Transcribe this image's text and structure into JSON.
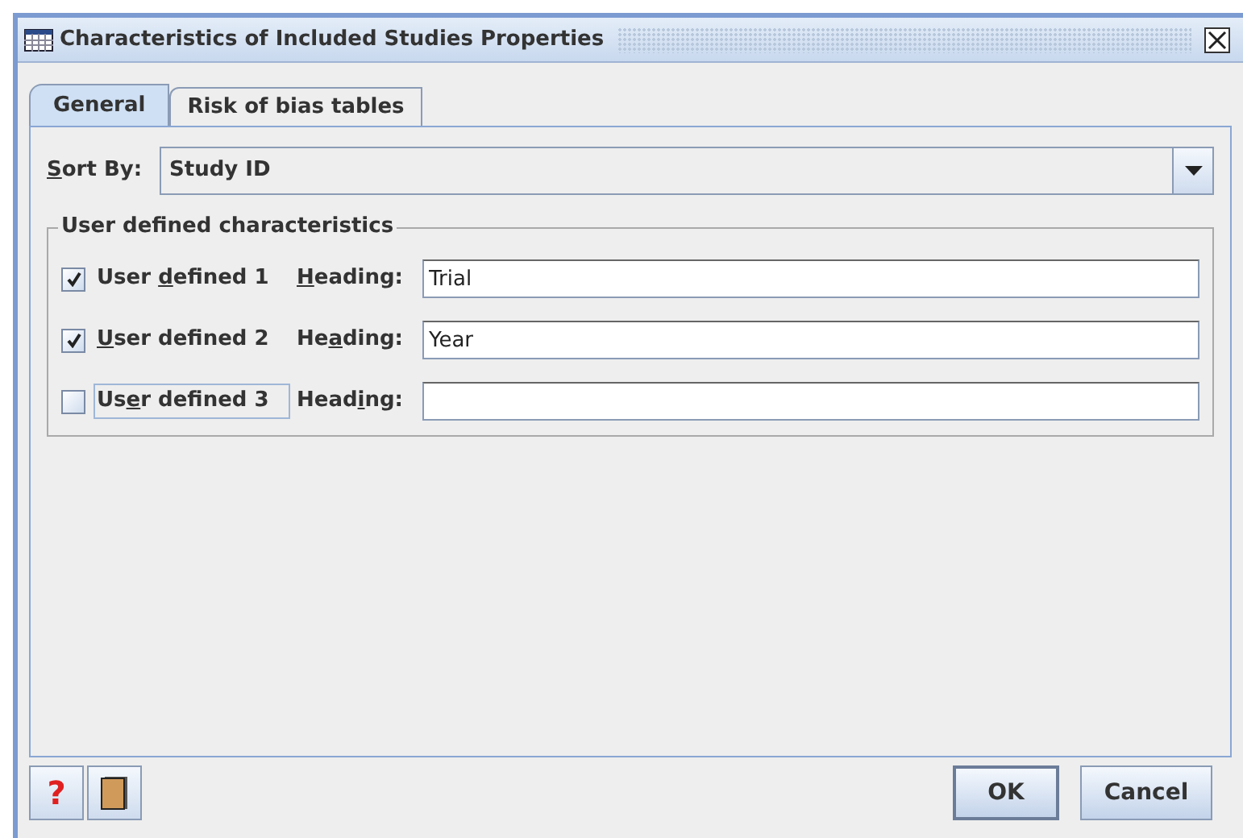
{
  "window": {
    "title": "Characteristics of Included Studies Properties"
  },
  "tabs": [
    {
      "label": "General",
      "selected": true
    },
    {
      "label": "Risk of bias tables",
      "selected": false
    }
  ],
  "sort_by": {
    "label": {
      "mnemonic": "S",
      "after": "ort By:"
    },
    "value": "Study ID"
  },
  "group": {
    "title": "User defined characteristics",
    "rows": [
      {
        "label": {
          "before": "User ",
          "mnemonic": "d",
          "after": "efined 1"
        },
        "checked": true,
        "focused": false,
        "heading_label": {
          "mnemonic": "H",
          "after": "eading:"
        },
        "value": "Trial"
      },
      {
        "label": {
          "mnemonic": "U",
          "after": "ser defined 2"
        },
        "checked": true,
        "focused": false,
        "heading_label": {
          "before": "He",
          "mnemonic": "a",
          "after": "ding:"
        },
        "value": "Year"
      },
      {
        "label": {
          "before": "Us",
          "mnemonic": "e",
          "after": "r defined 3"
        },
        "checked": false,
        "focused": true,
        "heading_label": {
          "before": "Head",
          "mnemonic": "i",
          "after": "ng:"
        }
      }
    ]
  },
  "help_button": {
    "label": "?"
  },
  "buttons": [
    {
      "label": "OK",
      "selected": true
    },
    {
      "label": "Cancel",
      "selected": false
    }
  ]
}
